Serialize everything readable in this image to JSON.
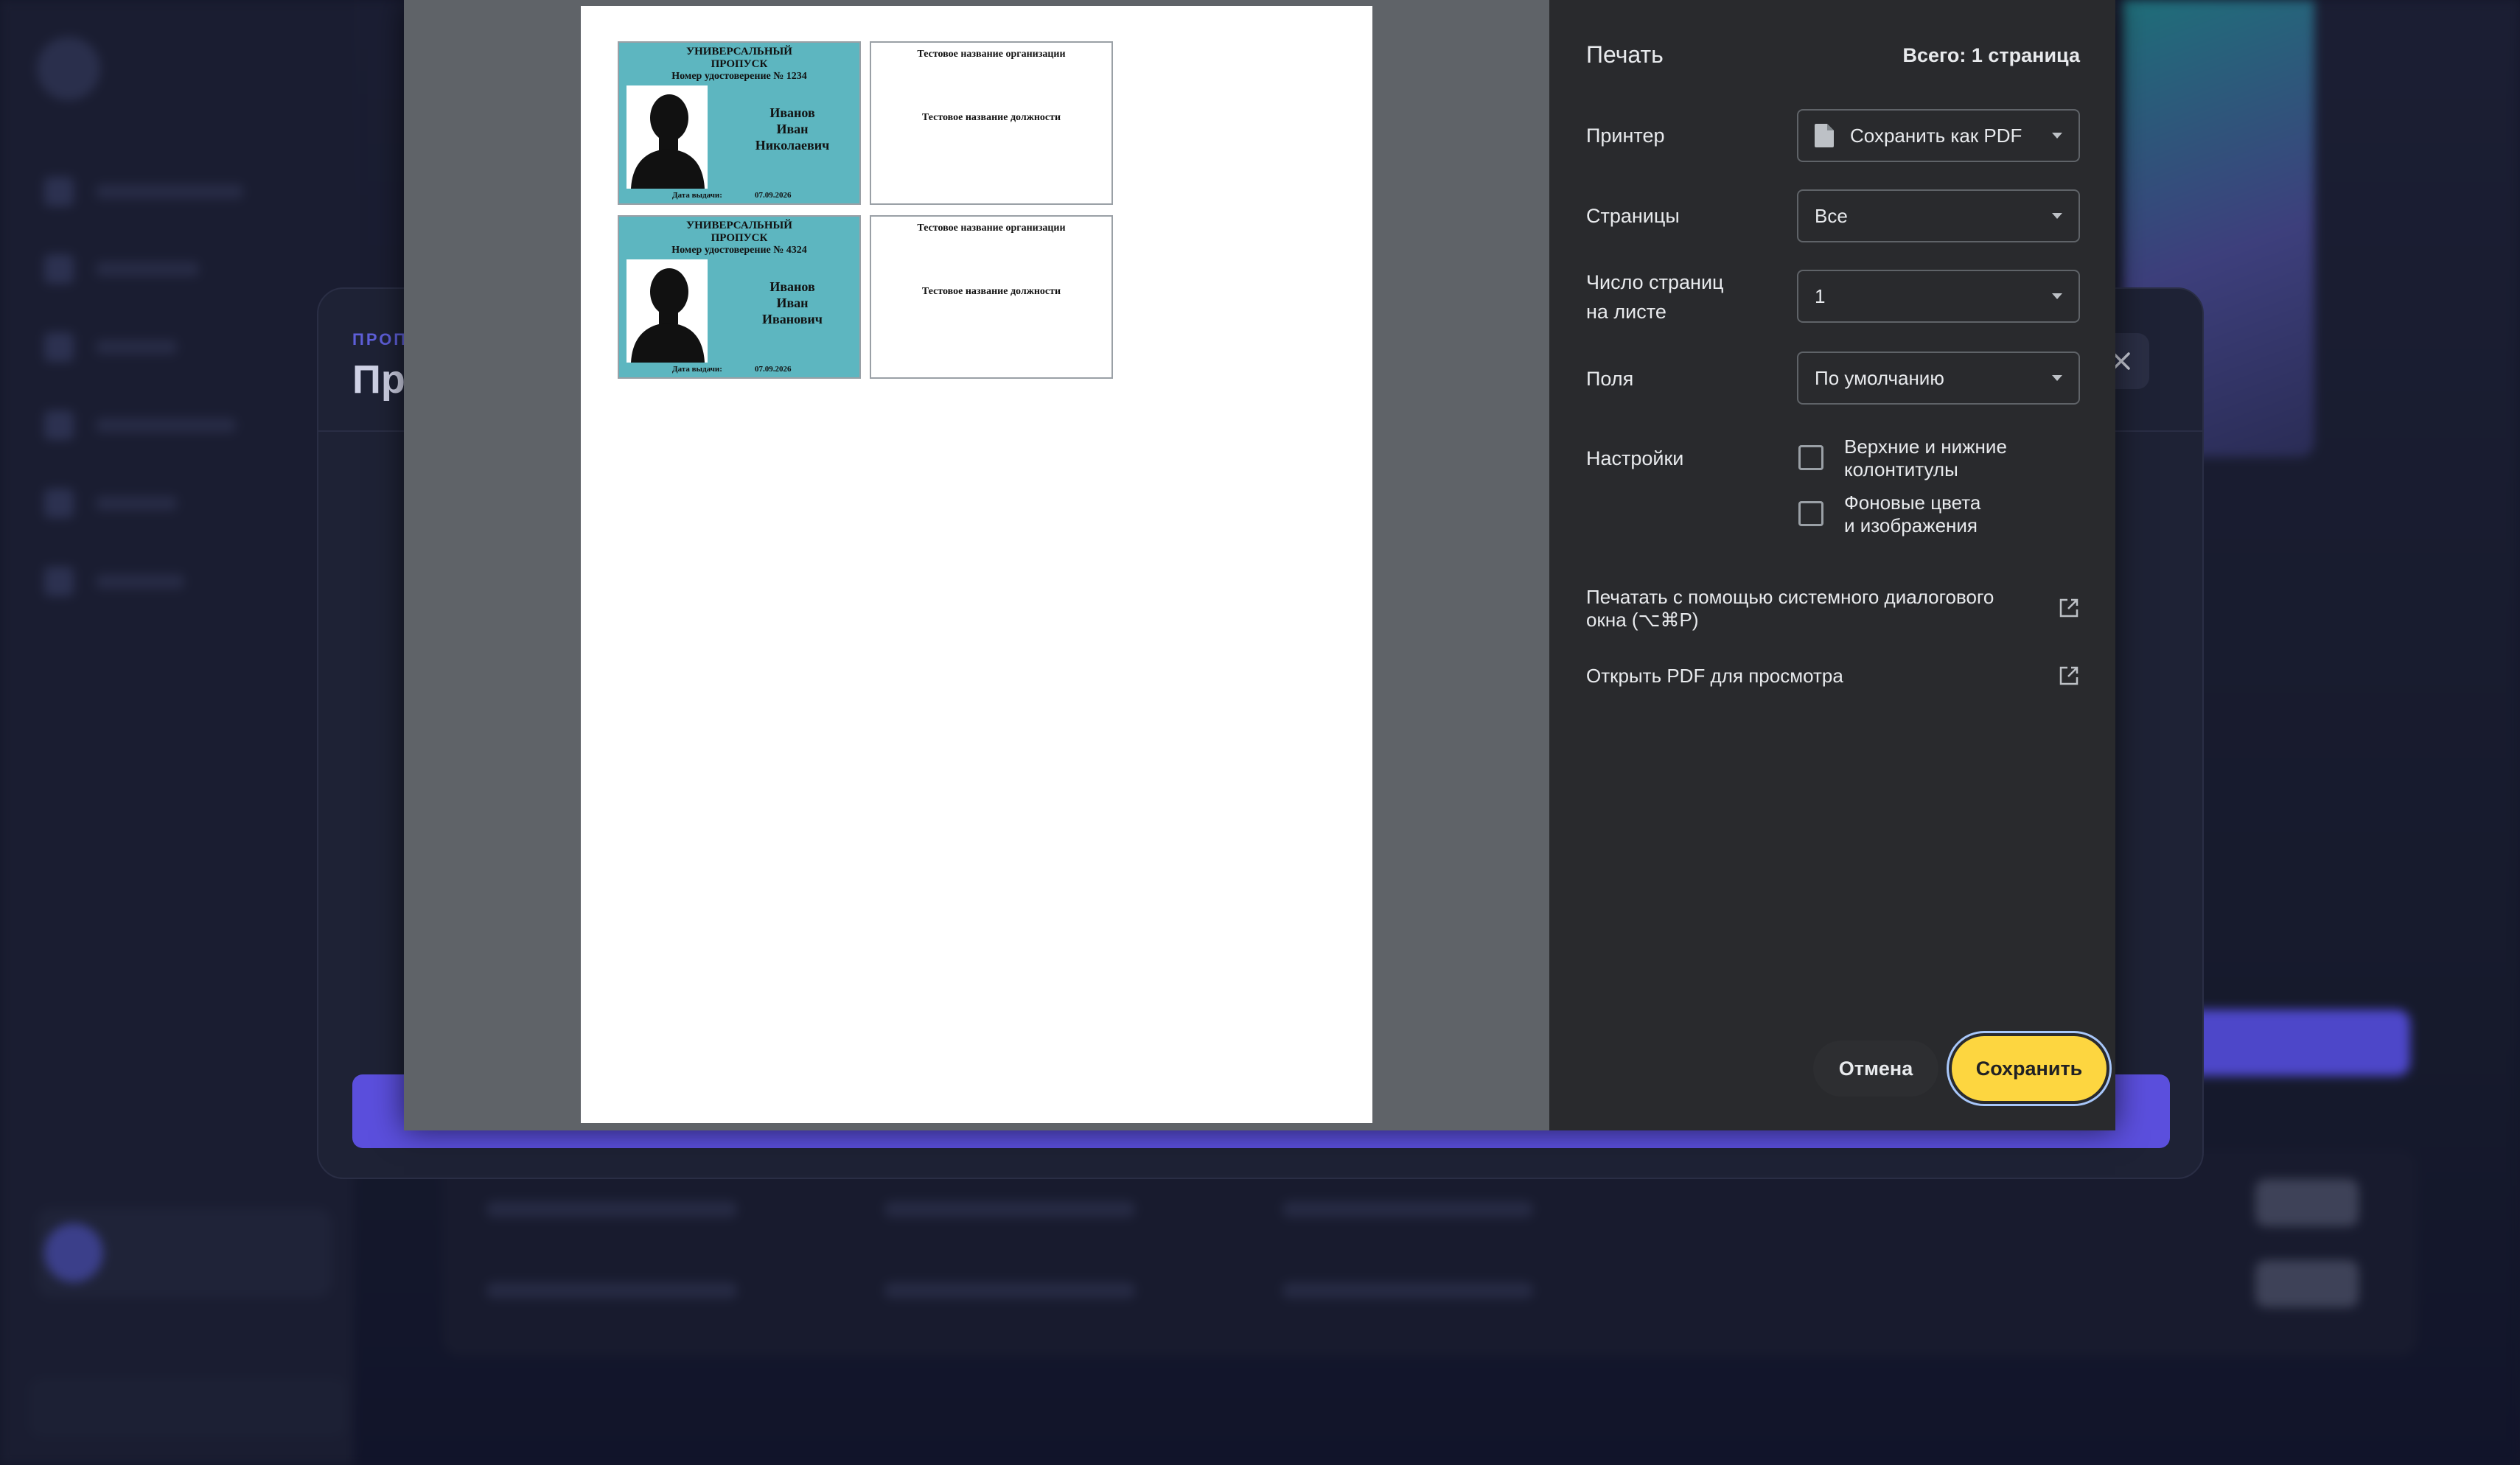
{
  "background": {
    "modal_crumb": "ПРОП",
    "modal_title": "Пр"
  },
  "print": {
    "title": "Печать",
    "total": "Всего: 1 страница",
    "printer": {
      "label": "Принтер",
      "value": "Сохранить как PDF",
      "icon": "pdf-file-icon"
    },
    "pages": {
      "label": "Страницы",
      "value": "Все"
    },
    "pages_per_sheet": {
      "label_line1": "Число страниц",
      "label_line2": "на листе",
      "value": "1"
    },
    "margins": {
      "label": "Поля",
      "value": "По умолчанию"
    },
    "settings": {
      "label": "Настройки",
      "headers_footers_line1": "Верхние и нижние",
      "headers_footers_line2": "колонтитулы",
      "headers_footers_checked": false,
      "backgrounds_line1": "Фоновые цвета",
      "backgrounds_line2": "и изображения",
      "backgrounds_checked": false
    },
    "system_dialog_line1": "Печатать с помощью системного диалогового",
    "system_dialog_line2": "окна (⌥⌘P)",
    "open_pdf": "Открыть PDF для просмотра",
    "cancel": "Отмена",
    "save": "Сохранить"
  },
  "badges": [
    {
      "title_line1": "УНИВЕРСАЛЬНЫЙ",
      "title_line2": "ПРОПУСК",
      "number": "Номер удостоверение № 1234",
      "last_name": "Иванов",
      "first_name": "Иван",
      "patronymic": "Николаевич",
      "issue_label": "Дата выдачи:",
      "issue_date": "07.09.2026",
      "org": "Тестовое название организации",
      "position": "Тестовое название должности"
    },
    {
      "title_line1": "УНИВЕРСАЛЬНЫЙ",
      "title_line2": "ПРОПУСК",
      "number": "Номер удостоверение № 4324",
      "last_name": "Иванов",
      "first_name": "Иван",
      "patronymic": "Иванович",
      "issue_label": "Дата выдачи:",
      "issue_date": "07.09.2026",
      "org": "Тестовое название организации",
      "position": "Тестовое название должности"
    }
  ],
  "colors": {
    "badge_front": "#5db6c0",
    "save_button": "#fdd640",
    "modal_accent": "#5b4fdd"
  }
}
